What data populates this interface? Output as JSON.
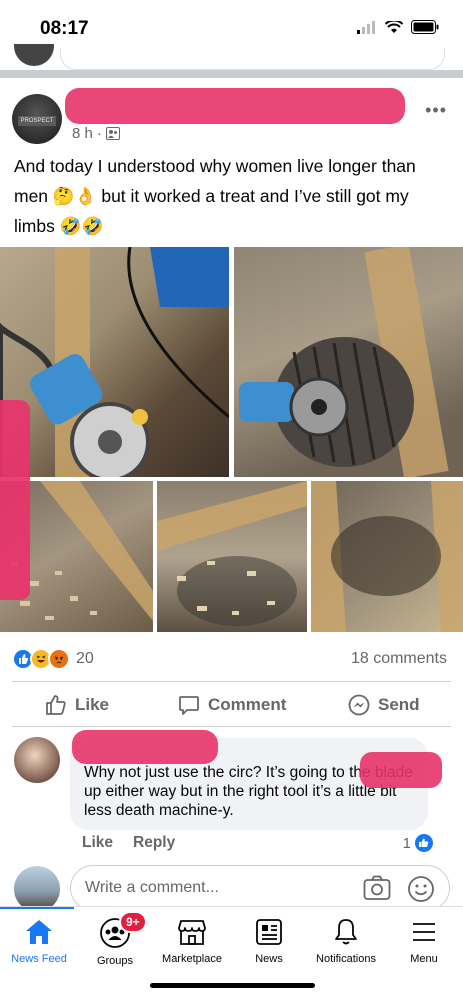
{
  "status_bar": {
    "time": "08:17"
  },
  "post": {
    "timestamp": "8 h",
    "audience_icon": "friends-icon",
    "text_line1": "And today I understood why women live longer than",
    "text_line2": "men 🤔👌 but it worked a treat and I’ve still got my",
    "text_line3": "limbs 🤣🤣",
    "avatar_badge": "PROSPECT",
    "reaction_count": "20",
    "comments_count": "18 comments"
  },
  "actions": {
    "like": "Like",
    "comment": "Comment",
    "send": "Send"
  },
  "comment": {
    "text": "Why not just use the circ? It’s going to the blade up either way but in the right tool it’s a little bit less death machine-y.",
    "like_label": "Like",
    "reply_label": "Reply",
    "like_count": "1"
  },
  "write_comment": {
    "placeholder": "Write a comment..."
  },
  "tabbar": {
    "badge": "9+",
    "tabs": [
      {
        "label": "News Feed",
        "icon": "home-icon",
        "active": true
      },
      {
        "label": "Groups",
        "icon": "groups-icon"
      },
      {
        "label": "Marketplace",
        "icon": "marketplace-icon"
      },
      {
        "label": "News",
        "icon": "news-icon"
      },
      {
        "label": "Notifications",
        "icon": "bell-icon"
      },
      {
        "label": "Menu",
        "icon": "menu-icon"
      }
    ]
  },
  "colors": {
    "accent": "#1877f2",
    "redaction": "#e8336a",
    "badge": "#e41e3f"
  }
}
